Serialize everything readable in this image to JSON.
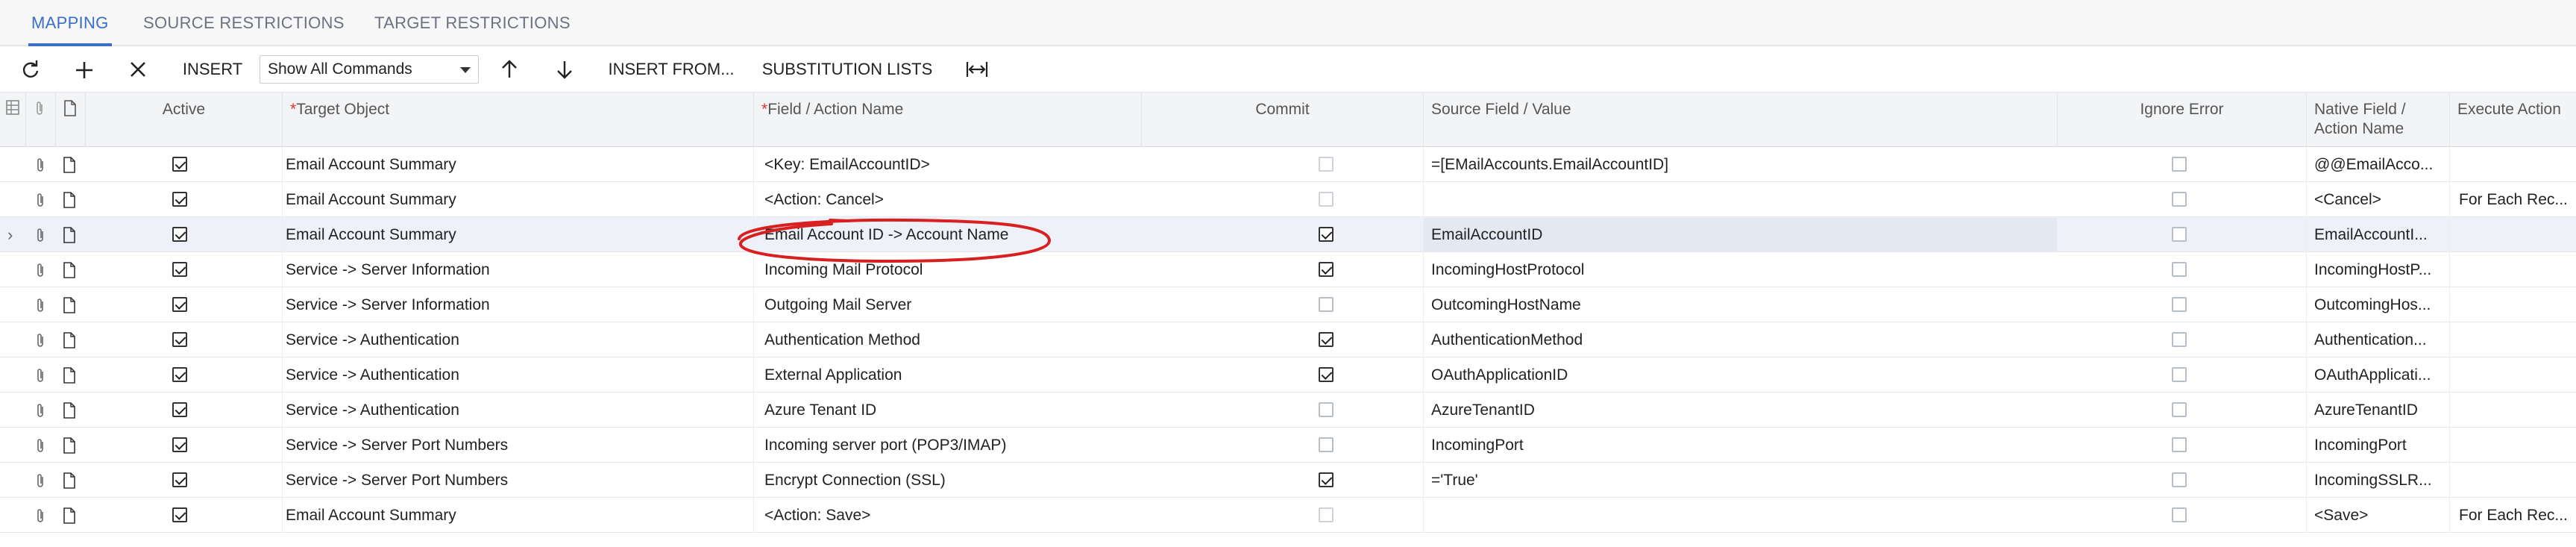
{
  "tabs": [
    {
      "label": "MAPPING",
      "active": true
    },
    {
      "label": "SOURCE RESTRICTIONS",
      "active": false
    },
    {
      "label": "TARGET RESTRICTIONS",
      "active": false
    }
  ],
  "toolbar": {
    "refresh_icon": "refresh-icon",
    "add_icon": "plus-icon",
    "delete_icon": "close-icon",
    "insert_label": "INSERT",
    "commands_select": "Show All Commands",
    "move_up_icon": "arrow-up-icon",
    "move_down_icon": "arrow-down-icon",
    "insert_from_label": "INSERT FROM...",
    "substitution_label": "SUBSTITUTION LISTS",
    "fit_icon": "fit-columns-icon"
  },
  "columns": {
    "active": "Active",
    "target_object": "Target Object",
    "field_action": "Field / Action Name",
    "commit": "Commit",
    "source_field": "Source Field / Value",
    "ignore_error": "Ignore Error",
    "native_field_line1": "Native Field /",
    "native_field_line2": "Action Name",
    "execute_action": "Execute Action"
  },
  "rows": [
    {
      "active": true,
      "target": "Email Account Summary",
      "field": "<Key: EmailAccountID>",
      "commit": false,
      "commit_dim": true,
      "source": "=[EMailAccounts.EmailAccountID]",
      "ignore": false,
      "native": "@@EmailAcco...",
      "execute": ""
    },
    {
      "active": true,
      "target": "Email Account Summary",
      "field": "<Action: Cancel>",
      "commit": false,
      "commit_dim": true,
      "source": "",
      "ignore": false,
      "native": "<Cancel>",
      "execute": "For Each Rec..."
    },
    {
      "active": true,
      "target": "Email Account Summary",
      "field": "Email Account ID -> Account Name",
      "commit": true,
      "commit_dim": false,
      "source": "EmailAccountID",
      "ignore": false,
      "native": "EmailAccountI...",
      "execute": "",
      "selected": true
    },
    {
      "active": true,
      "target": "Service -> Server Information",
      "field": "Incoming Mail Protocol",
      "commit": true,
      "commit_dim": false,
      "source": "IncomingHostProtocol",
      "ignore": false,
      "native": "IncomingHostP...",
      "execute": ""
    },
    {
      "active": true,
      "target": "Service -> Server Information",
      "field": "Outgoing Mail Server",
      "commit": false,
      "commit_dim": false,
      "source": "OutcomingHostName",
      "ignore": false,
      "native": "OutcomingHos...",
      "execute": ""
    },
    {
      "active": true,
      "target": "Service -> Authentication",
      "field": "Authentication Method",
      "commit": true,
      "commit_dim": false,
      "source": "AuthenticationMethod",
      "ignore": false,
      "native": "Authentication...",
      "execute": ""
    },
    {
      "active": true,
      "target": "Service -> Authentication",
      "field": "External Application",
      "commit": true,
      "commit_dim": false,
      "source": "OAuthApplicationID",
      "ignore": false,
      "native": "OAuthApplicati...",
      "execute": ""
    },
    {
      "active": true,
      "target": "Service -> Authentication",
      "field": "Azure Tenant ID",
      "commit": false,
      "commit_dim": false,
      "source": "AzureTenantID",
      "ignore": false,
      "native": "AzureTenantID",
      "execute": ""
    },
    {
      "active": true,
      "target": "Service -> Server Port Numbers",
      "field": "Incoming server port (POP3/IMAP)",
      "commit": false,
      "commit_dim": false,
      "source": "IncomingPort",
      "ignore": false,
      "native": "IncomingPort",
      "execute": ""
    },
    {
      "active": true,
      "target": "Service -> Server Port Numbers",
      "field": "Encrypt Connection (SSL)",
      "commit": true,
      "commit_dim": false,
      "source": "='True'",
      "ignore": false,
      "native": "IncomingSSLR...",
      "execute": ""
    },
    {
      "active": true,
      "target": "Email Account Summary",
      "field": "<Action: Save>",
      "commit": false,
      "commit_dim": true,
      "source": "",
      "ignore": false,
      "native": "<Save>",
      "execute": "For Each Rec..."
    }
  ],
  "colors": {
    "accent": "#3c6ec8",
    "annotation": "#d92020",
    "selected_row": "#eef1f7"
  }
}
